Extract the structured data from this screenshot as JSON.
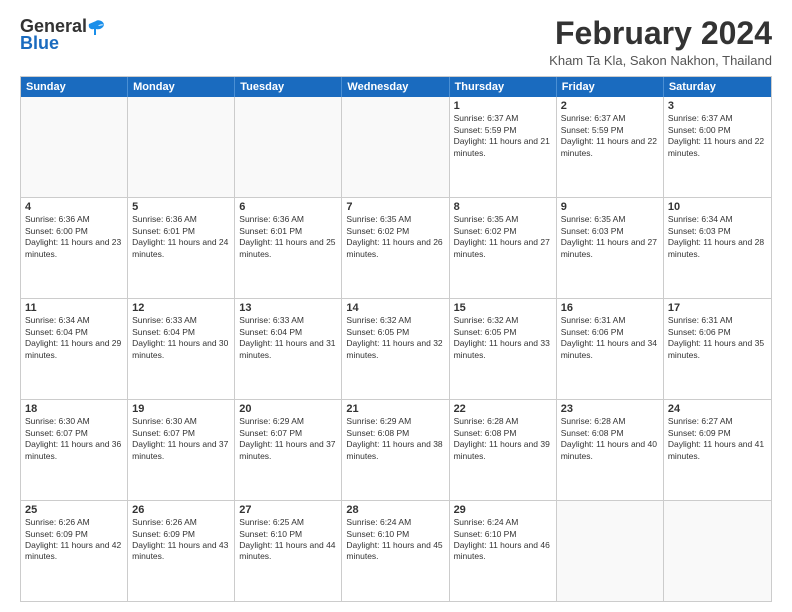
{
  "header": {
    "logo_general": "General",
    "logo_blue": "Blue",
    "month_title": "February 2024",
    "location": "Kham Ta Kla, Sakon Nakhon, Thailand"
  },
  "calendar": {
    "days_of_week": [
      "Sunday",
      "Monday",
      "Tuesday",
      "Wednesday",
      "Thursday",
      "Friday",
      "Saturday"
    ],
    "rows": [
      [
        {
          "day": "",
          "empty": true
        },
        {
          "day": "",
          "empty": true
        },
        {
          "day": "",
          "empty": true
        },
        {
          "day": "",
          "empty": true
        },
        {
          "day": "1",
          "sunrise": "6:37 AM",
          "sunset": "5:59 PM",
          "daylight": "11 hours and 21 minutes."
        },
        {
          "day": "2",
          "sunrise": "6:37 AM",
          "sunset": "5:59 PM",
          "daylight": "11 hours and 22 minutes."
        },
        {
          "day": "3",
          "sunrise": "6:37 AM",
          "sunset": "6:00 PM",
          "daylight": "11 hours and 22 minutes."
        }
      ],
      [
        {
          "day": "4",
          "sunrise": "6:36 AM",
          "sunset": "6:00 PM",
          "daylight": "11 hours and 23 minutes."
        },
        {
          "day": "5",
          "sunrise": "6:36 AM",
          "sunset": "6:01 PM",
          "daylight": "11 hours and 24 minutes."
        },
        {
          "day": "6",
          "sunrise": "6:36 AM",
          "sunset": "6:01 PM",
          "daylight": "11 hours and 25 minutes."
        },
        {
          "day": "7",
          "sunrise": "6:35 AM",
          "sunset": "6:02 PM",
          "daylight": "11 hours and 26 minutes."
        },
        {
          "day": "8",
          "sunrise": "6:35 AM",
          "sunset": "6:02 PM",
          "daylight": "11 hours and 27 minutes."
        },
        {
          "day": "9",
          "sunrise": "6:35 AM",
          "sunset": "6:03 PM",
          "daylight": "11 hours and 27 minutes."
        },
        {
          "day": "10",
          "sunrise": "6:34 AM",
          "sunset": "6:03 PM",
          "daylight": "11 hours and 28 minutes."
        }
      ],
      [
        {
          "day": "11",
          "sunrise": "6:34 AM",
          "sunset": "6:04 PM",
          "daylight": "11 hours and 29 minutes."
        },
        {
          "day": "12",
          "sunrise": "6:33 AM",
          "sunset": "6:04 PM",
          "daylight": "11 hours and 30 minutes."
        },
        {
          "day": "13",
          "sunrise": "6:33 AM",
          "sunset": "6:04 PM",
          "daylight": "11 hours and 31 minutes."
        },
        {
          "day": "14",
          "sunrise": "6:32 AM",
          "sunset": "6:05 PM",
          "daylight": "11 hours and 32 minutes."
        },
        {
          "day": "15",
          "sunrise": "6:32 AM",
          "sunset": "6:05 PM",
          "daylight": "11 hours and 33 minutes."
        },
        {
          "day": "16",
          "sunrise": "6:31 AM",
          "sunset": "6:06 PM",
          "daylight": "11 hours and 34 minutes."
        },
        {
          "day": "17",
          "sunrise": "6:31 AM",
          "sunset": "6:06 PM",
          "daylight": "11 hours and 35 minutes."
        }
      ],
      [
        {
          "day": "18",
          "sunrise": "6:30 AM",
          "sunset": "6:07 PM",
          "daylight": "11 hours and 36 minutes."
        },
        {
          "day": "19",
          "sunrise": "6:30 AM",
          "sunset": "6:07 PM",
          "daylight": "11 hours and 37 minutes."
        },
        {
          "day": "20",
          "sunrise": "6:29 AM",
          "sunset": "6:07 PM",
          "daylight": "11 hours and 37 minutes."
        },
        {
          "day": "21",
          "sunrise": "6:29 AM",
          "sunset": "6:08 PM",
          "daylight": "11 hours and 38 minutes."
        },
        {
          "day": "22",
          "sunrise": "6:28 AM",
          "sunset": "6:08 PM",
          "daylight": "11 hours and 39 minutes."
        },
        {
          "day": "23",
          "sunrise": "6:28 AM",
          "sunset": "6:08 PM",
          "daylight": "11 hours and 40 minutes."
        },
        {
          "day": "24",
          "sunrise": "6:27 AM",
          "sunset": "6:09 PM",
          "daylight": "11 hours and 41 minutes."
        }
      ],
      [
        {
          "day": "25",
          "sunrise": "6:26 AM",
          "sunset": "6:09 PM",
          "daylight": "11 hours and 42 minutes."
        },
        {
          "day": "26",
          "sunrise": "6:26 AM",
          "sunset": "6:09 PM",
          "daylight": "11 hours and 43 minutes."
        },
        {
          "day": "27",
          "sunrise": "6:25 AM",
          "sunset": "6:10 PM",
          "daylight": "11 hours and 44 minutes."
        },
        {
          "day": "28",
          "sunrise": "6:24 AM",
          "sunset": "6:10 PM",
          "daylight": "11 hours and 45 minutes."
        },
        {
          "day": "29",
          "sunrise": "6:24 AM",
          "sunset": "6:10 PM",
          "daylight": "11 hours and 46 minutes."
        },
        {
          "day": "",
          "empty": true
        },
        {
          "day": "",
          "empty": true
        }
      ]
    ],
    "sunrise_label": "Sunrise:",
    "sunset_label": "Sunset:",
    "daylight_label": "Daylight:"
  }
}
